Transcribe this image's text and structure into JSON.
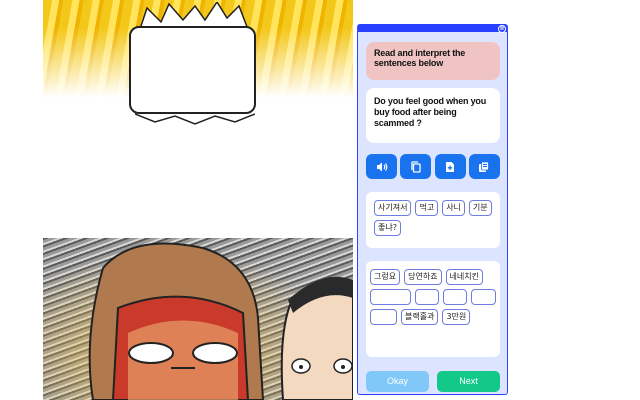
{
  "popup": {
    "close_label": "⊗",
    "instruction": "Read and interpret the sentences below",
    "sentence": "Do you feel good when you buy food after being scammed ?",
    "toolbar": {
      "icons": [
        "speaker-icon",
        "copy-icon",
        "add-file-icon",
        "cards-icon"
      ]
    },
    "word_bank": [
      "사기져서",
      "먹고",
      "사니",
      "기분",
      "좋냐?"
    ],
    "answer_row1": [
      "그렁요",
      "당연하죠",
      "네네치킨"
    ],
    "answer_row3_chip": "블랙홀과",
    "answer_last": "3만원",
    "okay_label": "Okay",
    "next_label": "Next",
    "colors": {
      "header": "#2840ff",
      "instruction_bg": "#f1c4c4",
      "tool_button": "#1a73ee",
      "okay": "#7fc8f8",
      "next": "#12c98a"
    }
  }
}
